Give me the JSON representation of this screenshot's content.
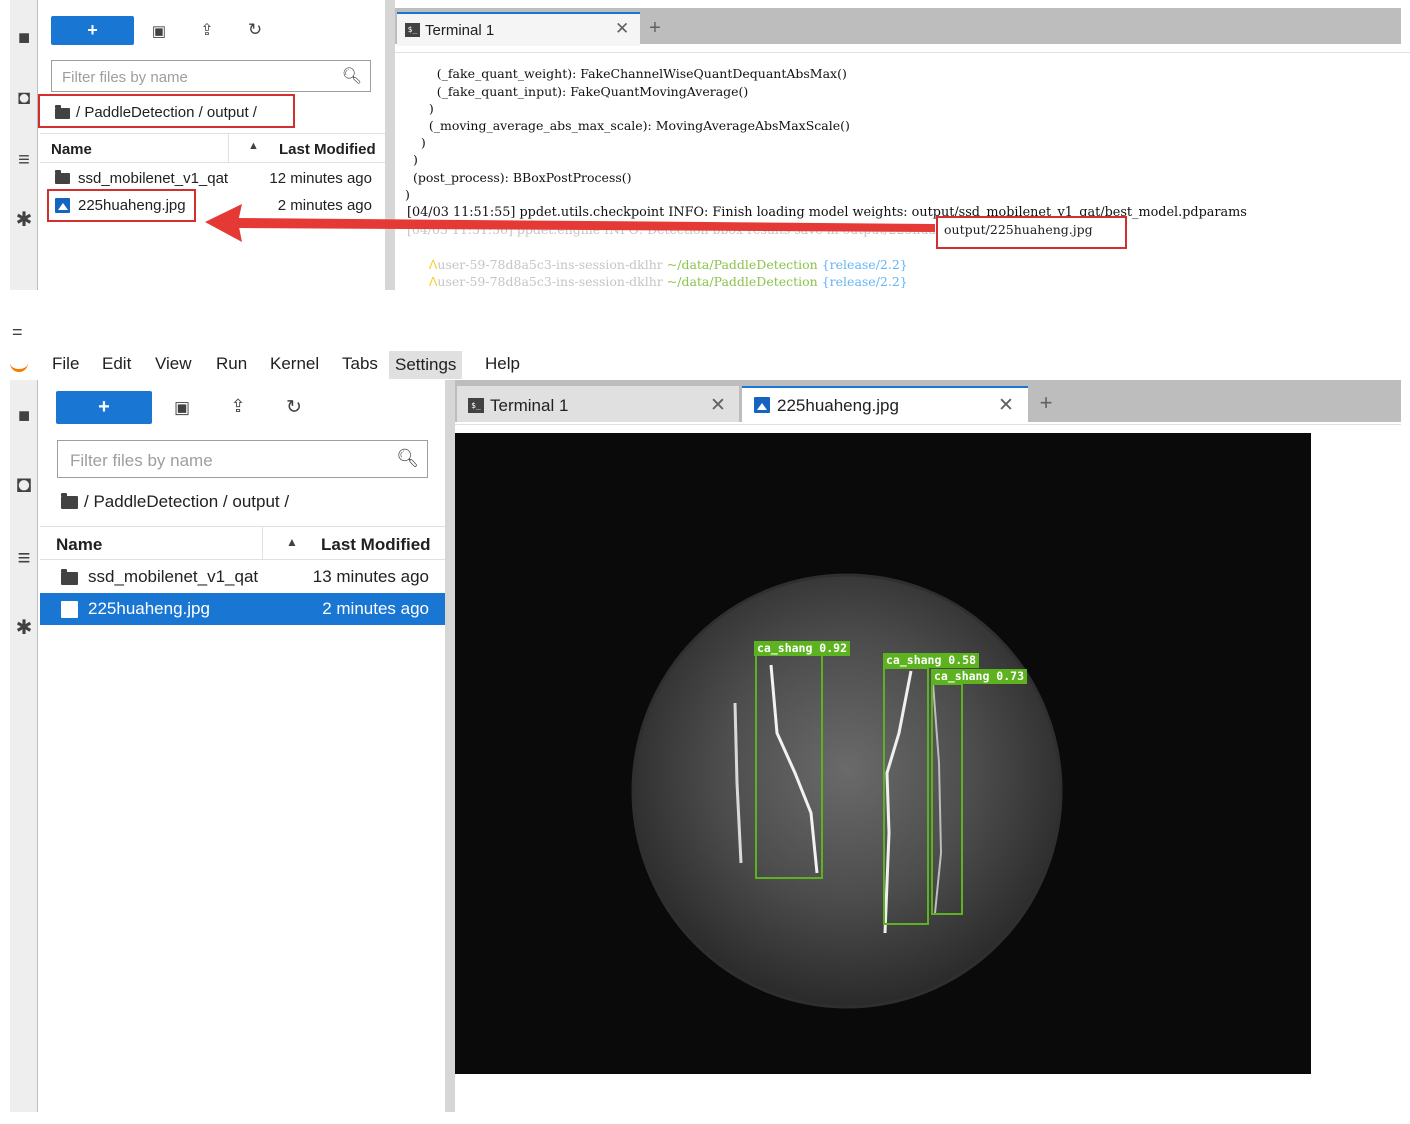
{
  "top": {
    "file_browser": {
      "new_button_label": "+",
      "filter_placeholder": "Filter files by name",
      "breadcrumb": "/ PaddleDetection / output /",
      "columns": {
        "name": "Name",
        "last_modified": "Last Modified"
      },
      "rows": [
        {
          "name": "ssd_mobilenet_v1_qat",
          "modified": "12 minutes ago",
          "kind": "folder"
        },
        {
          "name": "225huaheng.jpg",
          "modified": "2 minutes ago",
          "kind": "image"
        }
      ]
    },
    "tabs": [
      {
        "label": "Terminal 1",
        "icon": "terminal-icon"
      }
    ],
    "terminal_lines": [
      "        (_fake_quant_weight): FakeChannelWiseQuantDequantAbsMax()",
      "        (_fake_quant_input): FakeQuantMovingAverage()",
      "      )",
      "      (_moving_average_abs_max_scale): MovingAverageAbsMaxScale()",
      "    )",
      "  )",
      "  (post_process): BBoxPostProcess()",
      ")",
      "[04/03 11:51:55] ppdet.utils.checkpoint INFO: Finish loading model weights: output/ssd_mobilenet_v1_qat/best_model.pdparams",
      "[04/03 11:51:56] ppdet.engine INFO: Detection bbox results save in output/225huaheng.jpg"
    ],
    "prompt": {
      "user": "user-59-78d8a5c3-ins-session-dklhr",
      "path": "~/data/PaddleDetection",
      "branch": "{release/2.2}"
    },
    "annotation": {
      "arrow_color": "#e53935",
      "box_color": "#d32f2f",
      "highlight": "output/225huaheng.jpg"
    }
  },
  "bottom": {
    "hamburger": "=",
    "menu": [
      "File",
      "Edit",
      "View",
      "Run",
      "Kernel",
      "Tabs",
      "Settings",
      "Help"
    ],
    "active_menu": "Settings",
    "file_browser": {
      "new_button_label": "+",
      "filter_placeholder": "Filter files by name",
      "breadcrumb": "/ PaddleDetection / output /",
      "columns": {
        "name": "Name",
        "last_modified": "Last Modified"
      },
      "rows": [
        {
          "name": "ssd_mobilenet_v1_qat",
          "modified": "13 minutes ago",
          "kind": "folder"
        },
        {
          "name": "225huaheng.jpg",
          "modified": "2 minutes ago",
          "kind": "image",
          "selected": true
        }
      ]
    },
    "tabs": [
      {
        "label": "Terminal 1",
        "icon": "terminal-icon"
      },
      {
        "label": "225huaheng.jpg",
        "icon": "image-icon"
      }
    ],
    "detections": [
      {
        "label": "ca_shang 0.92"
      },
      {
        "label": "ca_shang 0.58"
      },
      {
        "label": "ca_shang 0.73"
      }
    ],
    "colors": {
      "accent": "#1976d2",
      "selected_row": "#1976d2",
      "detection": "#5db31f"
    }
  }
}
